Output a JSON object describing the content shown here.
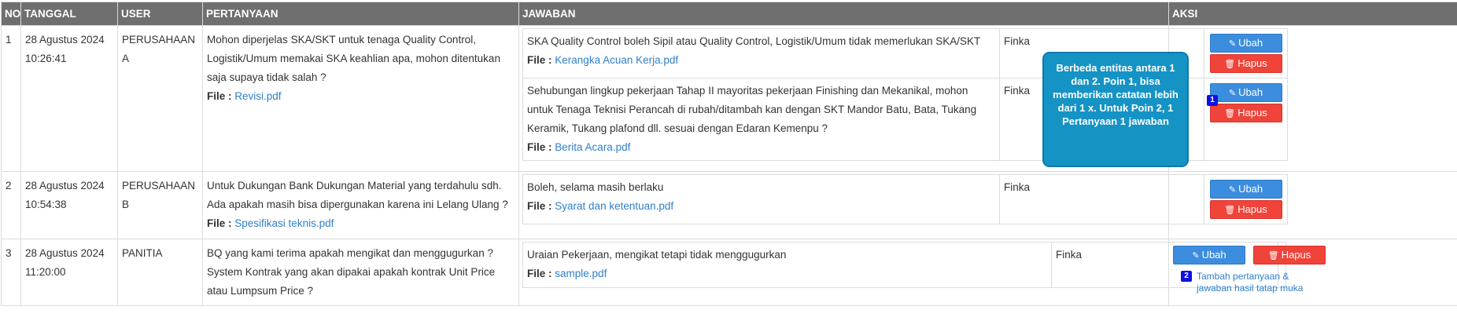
{
  "headers": {
    "no": "NO",
    "tanggal": "TANGGAL",
    "user": "USER",
    "pertanyaan": "PERTANYAAN",
    "jawaban": "JAWABAN",
    "aksi": "AKSI"
  },
  "file_label": "File :",
  "buttons": {
    "ubah": "Ubah",
    "hapus": "Hapus"
  },
  "rows": [
    {
      "no": "1",
      "date": "28 Agustus 2024",
      "time": "10:26:41",
      "user_line1": "PERUSAHAAN",
      "user_line2": "A",
      "question": "Mohon diperjelas SKA/SKT untuk tenaga Quality Control, Logistik/Umum memakai SKA keahlian apa, mohon ditentukan saja supaya tidak salah ?",
      "question_file": "Revisi.pdf",
      "answers": [
        {
          "text": "SKA Quality Control boleh Sipil atau Quality Control, Logistik/Umum tidak memerlukan SKA/SKT",
          "file": "Kerangka Acuan Kerja.pdf",
          "by": "Finka"
        },
        {
          "text": "Sehubungan lingkup pekerjaan Tahap II mayoritas pekerjaan Finishing dan Mekanikal, mohon untuk Tenaga Teknisi Perancah di rubah/ditambah kan dengan SKT Mandor Batu, Bata, Tukang Keramik, Tukang plafond dll. sesuai dengan Edaran Kemenpu ?",
          "file": "Berita Acara.pdf",
          "by": "Finka"
        }
      ],
      "aksi_badge": "1"
    },
    {
      "no": "2",
      "date": "28 Agustus 2024",
      "time": "10:54:38",
      "user_line1": "PERUSAHAAN",
      "user_line2": "B",
      "question": "Untuk Dukungan Bank Dukungan Material yang terdahulu sdh. Ada apakah masih bisa dipergunakan karena ini Lelang Ulang ?",
      "question_file": "Spesifikasi teknis.pdf",
      "answers": [
        {
          "text": "Boleh, selama masih berlaku",
          "file": "Syarat dan ketentuan.pdf",
          "by": "Finka"
        }
      ]
    },
    {
      "no": "3",
      "date": "28 Agustus 2024",
      "time": "11:20:00",
      "user_line1": "PANITIA",
      "question": "BQ yang kami terima apakah mengikat dan menggugurkan ? System Kontrak yang akan dipakai apakah kontrak Unit Price atau Lumpsum Price ?",
      "answers": [
        {
          "text": "Uraian Pekerjaan, mengikat tetapi tidak menggugurkan",
          "file": "sample.pdf",
          "by": "Finka"
        }
      ],
      "aksi_badge": "2",
      "aksi_link": "Tambah pertanyaan & jawaban hasil tatap muka"
    }
  ],
  "tooltip": "Berbeda entitas antara 1 dan 2. Poin 1, bisa memberikan catatan lebih dari 1 x. Untuk Poin 2, 1 Pertanyaan 1 jawaban",
  "icons": {
    "edit": "edit-icon",
    "delete": "trash-icon"
  },
  "colors": {
    "header_bg": "#6f6f6f",
    "primary": "#3c8dde",
    "danger": "#f0433a",
    "tooltip_bg": "#1593c5"
  }
}
